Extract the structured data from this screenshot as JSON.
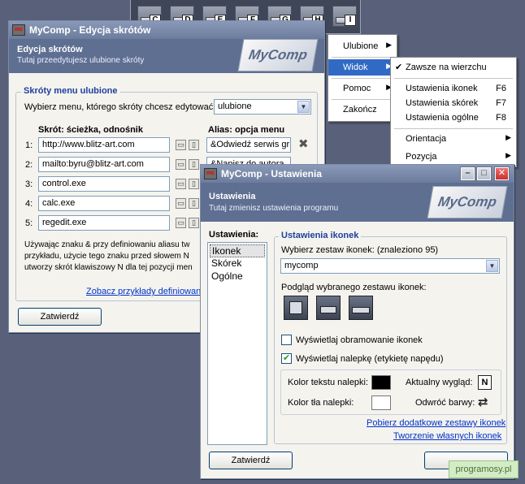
{
  "drivebar": {
    "drives": [
      "C",
      "D",
      "E",
      "F",
      "G",
      "H",
      "I"
    ]
  },
  "main_menu": {
    "items": [
      {
        "label": "Ulubione",
        "submenu": true
      },
      {
        "label": "Widok",
        "submenu": true,
        "highlighted": true
      },
      {
        "label": "Pomoc",
        "submenu": true
      },
      {
        "label": "Zakończ",
        "submenu": false
      }
    ]
  },
  "widok_menu": {
    "always_on_top": "Zawsze na wierzchu",
    "icon_settings": "Ustawienia ikonek",
    "icon_settings_key": "F6",
    "skin_settings": "Ustawienia skórek",
    "skin_settings_key": "F7",
    "general_settings": "Ustawienia ogólne",
    "general_settings_key": "F8",
    "orientation": "Orientacja",
    "position": "Pozycja"
  },
  "shortcuts_window": {
    "title": "MyComp - Edycja skrótów",
    "app_icon": "mc",
    "banner_title": "Edycja skrótów",
    "banner_subtitle": "Tutaj przeedytujesz ulubione skróty",
    "logo": "MyComp",
    "group_title": "Skróty menu ulubione",
    "choose_menu_label": "Wybierz menu, którego skróty chcesz edytować:",
    "menu_selected": "ulubione",
    "col_shortcut": "Skrót: ścieżka, odnośnik",
    "col_alias": "Alias: opcja menu",
    "rows": [
      {
        "num": "1:",
        "path": "http://www.blitz-art.com",
        "alias": "&Odwiedź serwis gru"
      },
      {
        "num": "2:",
        "path": "mailto:byru@blitz-art.com",
        "alias": "&Napisz do autora"
      },
      {
        "num": "3:",
        "path": "control.exe",
        "alias": ""
      },
      {
        "num": "4:",
        "path": "calc.exe",
        "alias": ""
      },
      {
        "num": "5:",
        "path": "regedit.exe",
        "alias": ""
      }
    ],
    "help_line1": "Używając znaku & przy definiowaniu aliasu tw",
    "help_line2": "przykładu, użycie tego znaku przed słowem N",
    "help_line3": "utworzy skrót klawiszowy N dla tej pozycji men",
    "examples_link": "Zobacz przykłady definiowan",
    "confirm": "Zatwierdź"
  },
  "settings_window": {
    "title": "MyComp - Ustawienia",
    "app_icon": "mc",
    "banner_title": "Ustawienia",
    "banner_subtitle": "Tutaj zmienisz ustawienia programu",
    "logo": "MyComp",
    "side_title": "Ustawienia:",
    "side_items": [
      "Ikonek",
      "Skórek",
      "Ogólne"
    ],
    "group_title": "Ustawienia ikonek",
    "choose_set_label": "Wybierz zestaw ikonek: (znaleziono 95)",
    "set_selected": "mycomp",
    "preview_label": "Podgląd wybranego zestawu ikonek:",
    "show_border": "Wyświetlaj obramowanie ikonek",
    "show_border_checked": false,
    "show_label": "Wyświetlaj nalepkę (etykietę napędu)",
    "show_label_checked": true,
    "text_color_label": "Kolor tekstu nalepki:",
    "text_color": "#000000",
    "bg_color_label": "Kolor tła nalepki:",
    "bg_color": "#ffffff",
    "current_look_label": "Aktualny wygląd:",
    "current_look_value": "N",
    "invert_colors_label": "Odwróć barwy:",
    "more_sets_link": "Pobierz dodatkowe zestawy ikonek",
    "create_own_link": "Tworzenie własnych ikonek",
    "confirm": "Zatwierdź"
  },
  "watermark": "programosy.pl"
}
